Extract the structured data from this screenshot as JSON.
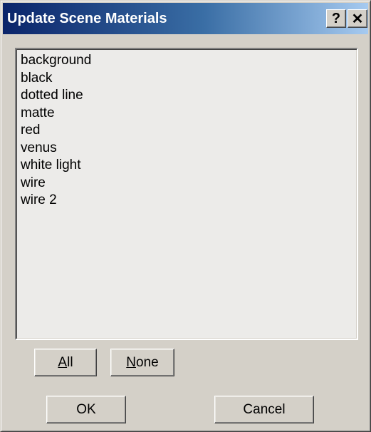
{
  "window": {
    "title": "Update Scene Materials",
    "help_label": "?",
    "close_label": "✕"
  },
  "materials": {
    "items": [
      "background",
      "black",
      "dotted line",
      "matte",
      "red",
      "venus",
      "white light",
      "wire",
      "wire 2"
    ]
  },
  "buttons": {
    "all": {
      "mnemonic": "A",
      "rest": "ll"
    },
    "none": {
      "mnemonic": "N",
      "rest": "one"
    },
    "ok": "OK",
    "cancel": "Cancel"
  },
  "colors": {
    "title_start": "#0a246a",
    "title_end": "#a6caf0",
    "face": "#d4d0c8",
    "list_bg": "#ecebe9"
  }
}
